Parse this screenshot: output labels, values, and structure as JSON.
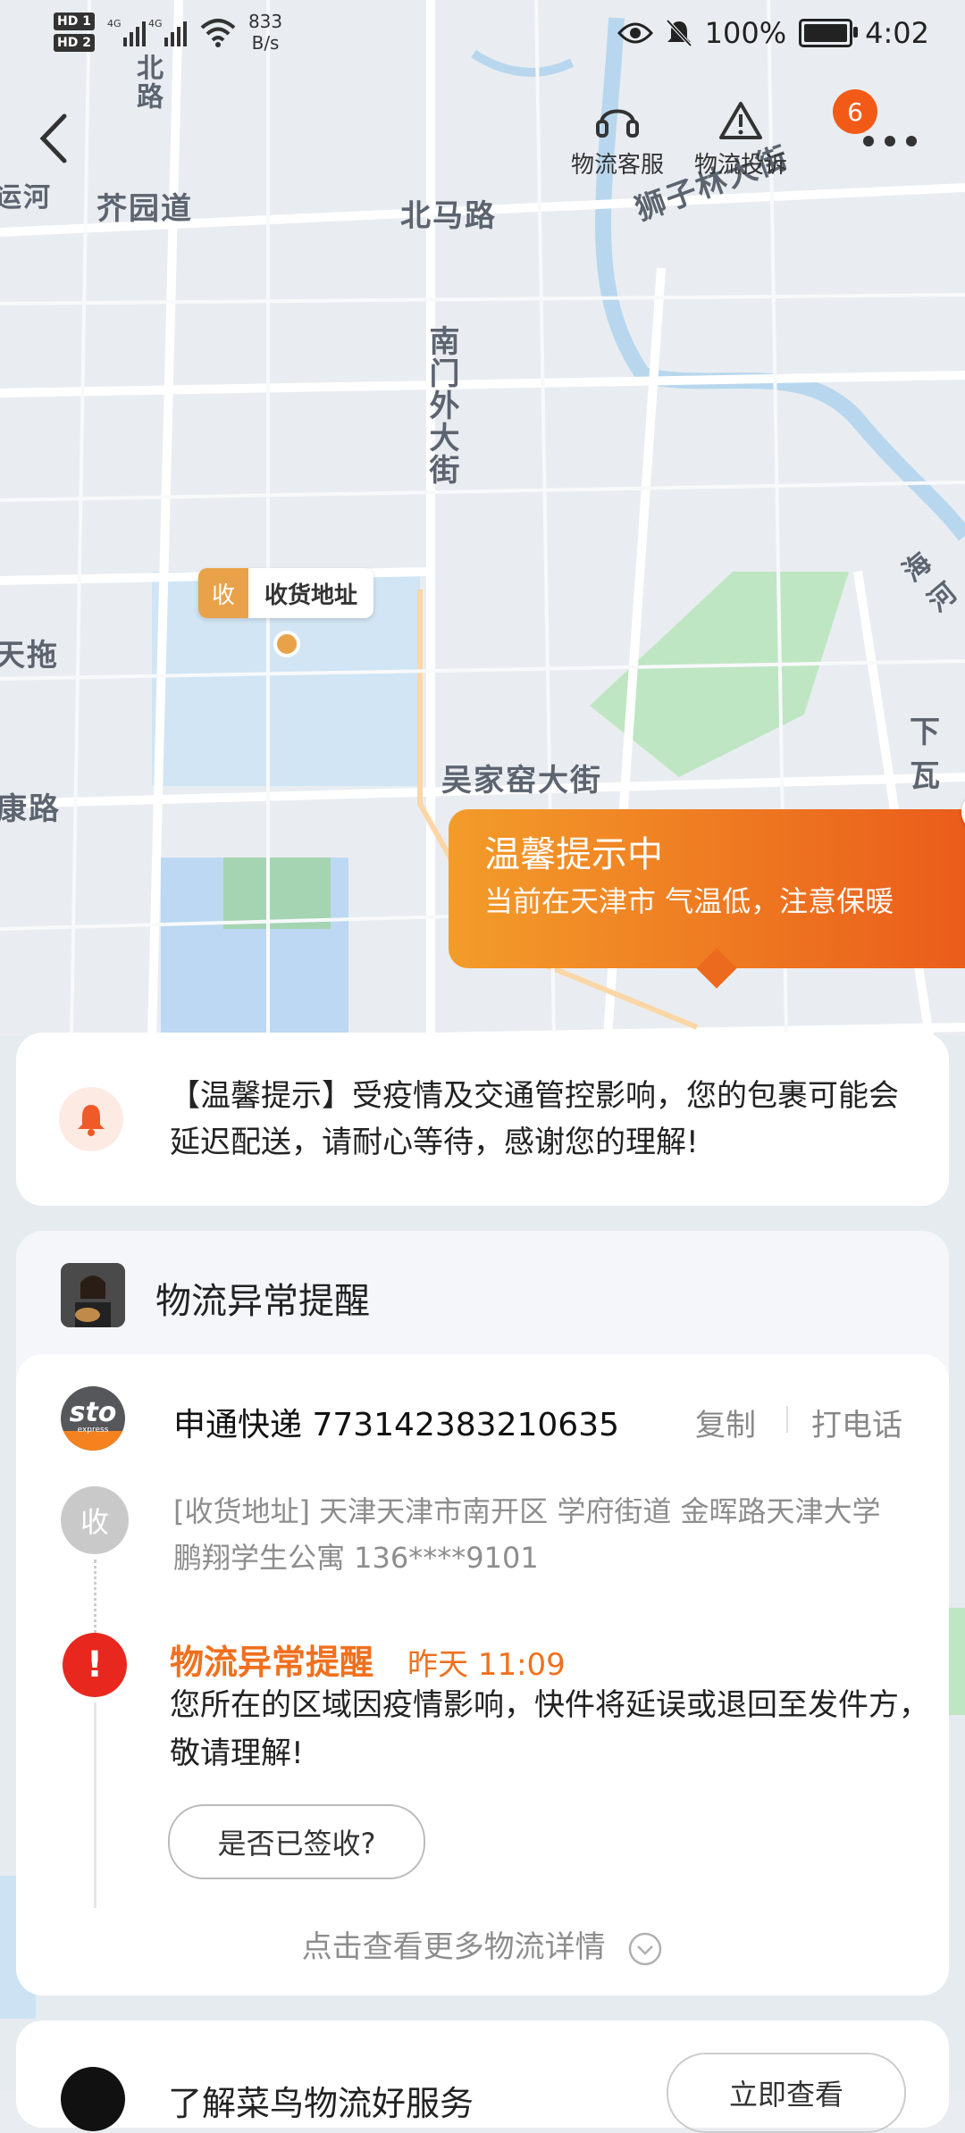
{
  "status_bar": {
    "hd1": "HD 1",
    "hd2": "HD 2",
    "net_speed_value": "833",
    "net_speed_unit": "B/s",
    "battery": "100%",
    "time": "4:02"
  },
  "nav": {
    "service_label": "物流客服",
    "complaint_label": "物流投诉",
    "more_badge": "6"
  },
  "map": {
    "labels": {
      "jieyuan_road": "芥园道",
      "beima_road": "北马路",
      "nanmenwai_street": "南门外大街",
      "wujiayao_street": "吴家窑大街",
      "shizilin_street": "狮子林大街",
      "yunhe": "运河",
      "bei_road": "北路",
      "tiantuo": "天拖",
      "kang_road": "康路",
      "haihe": "海河",
      "xiawa": "下瓦"
    },
    "pin": {
      "tag": "收",
      "label": "收货地址"
    }
  },
  "tip_bubble": {
    "title": "温馨提示中",
    "text": "当前在天津市  气温低，注意保暖"
  },
  "notice": {
    "text": "【温馨提示】受疫情及交通管控影响，您的包裹可能会延迟配送，请耐心等待，感谢您的理解!"
  },
  "abnormal": {
    "title": "物流异常提醒"
  },
  "shipment": {
    "carrier_tracking": "申通快递 773142383210635",
    "copy_label": "复制",
    "call_label": "打电话",
    "carrier_logo_text": "sto",
    "carrier_logo_sub": "express",
    "receive_tag": "收",
    "receive_address": "[收货地址] 天津天津市南开区 学府街道   金晖路天津大学鹏翔学生公寓 136****9101",
    "event_title": "物流异常提醒",
    "event_time": "昨天  11:09",
    "event_desc": "您所在的区域因疫情影响，快件将延误或退回至发件方，敬请理解!",
    "sign_button": "是否已签收?",
    "more_details": "点击查看更多物流详情"
  },
  "bottom": {
    "title": "了解菜鸟物流好服务",
    "button": "立即查看"
  },
  "colors": {
    "accent_orange": "#f0701e",
    "alert_red": "#e8281e",
    "badge_orange": "#f25b17",
    "tip_gradient_start": "#f39c2a",
    "tip_gradient_end": "#ea5a1a"
  }
}
